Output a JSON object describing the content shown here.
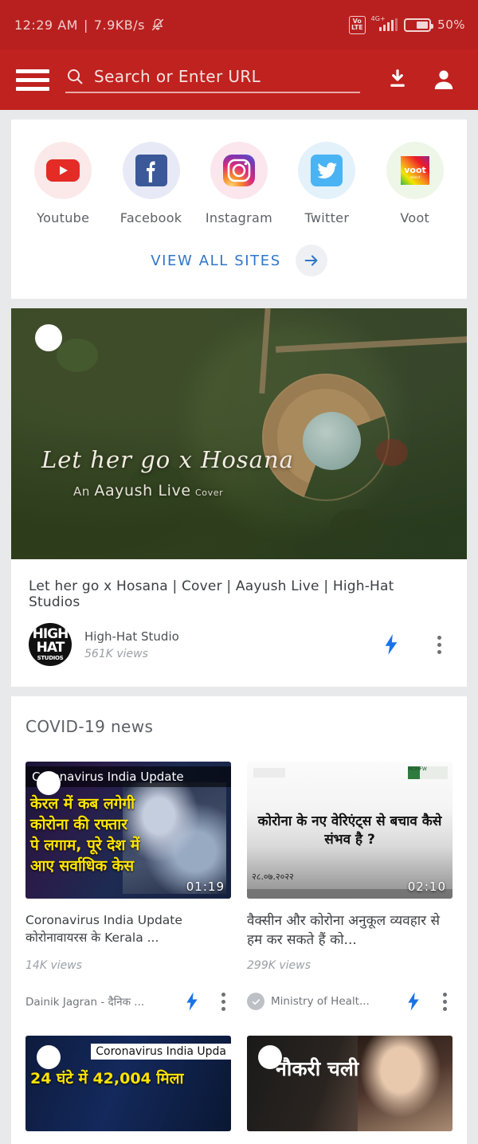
{
  "statusbar": {
    "time": "12:29 AM",
    "separator": "|",
    "netspeed": "7.9KB/s",
    "mute_icon": "bell-muted-icon",
    "volte_line1": "Vo",
    "volte_line2": "LTE",
    "signal_label": "4G+",
    "battery_pct": "50%"
  },
  "toolbar": {
    "menu_icon": "hamburger-menu-icon",
    "search_placeholder": "Search or Enter URL",
    "search_icon": "search-icon",
    "download_icon": "download-icon",
    "profile_icon": "profile-icon"
  },
  "shortcuts": {
    "tiles": [
      {
        "label": "Youtube",
        "icon": "youtube-icon",
        "bg": "#fbe9e9"
      },
      {
        "label": "Facebook",
        "icon": "facebook-icon",
        "bg": "#e7eaf6"
      },
      {
        "label": "Instagram",
        "icon": "instagram-icon",
        "bg": "#fbe6ee"
      },
      {
        "label": "Twitter",
        "icon": "twitter-icon",
        "bg": "#e3f1fb"
      },
      {
        "label": "Voot",
        "icon": "voot-icon",
        "bg": "#eef6e8"
      }
    ],
    "view_all_label": "VIEW ALL SITES",
    "view_all_arrow_icon": "arrow-right-icon"
  },
  "video": {
    "thumb_title": "Let her go x Hosana",
    "thumb_subtitle_pre": "An",
    "thumb_subtitle_mid": "Aayush Live",
    "thumb_subtitle_post": "Cover",
    "play_badge_icon": "play-badge-icon",
    "title": "Let her go x Hosana | Cover | Aayush Live | High-Hat Studios",
    "channel": "High-Hat Studio",
    "views": "561K views",
    "avatar_line1": "HIGH",
    "avatar_line2": "HAT",
    "avatar_line3": "STUDIOS",
    "bolt_icon": "lightning-bolt-icon",
    "menu_icon": "more-options-icon"
  },
  "news": {
    "heading": "COVID-19 news",
    "items": [
      {
        "banner": "Coronavirus India Update",
        "overlay_l1": "केरल में कब लगेगी",
        "overlay_l2": "कोरोना की रफ्तार",
        "overlay_l3": "पे लगाम, पूरे देश में",
        "overlay_l4": "आए सर्वाधिक केस",
        "duration": "01:19",
        "title": "Coronavirus India Update कोरोनावायरस के Kerala ...",
        "views": "14K views",
        "source": "Dainik Jagran - दैनिक ...",
        "verified": false,
        "bolt_icon": "lightning-bolt-icon",
        "menu_icon": "more-options-icon"
      },
      {
        "headline": "कोरोना के नए वेरिएंट्स से बचाव कैसे संभव है ?",
        "date": "२८.०७.२०२२",
        "duration": "02:10",
        "logo_text": "MOHFW",
        "title": "वैक्सीन और कोरोना अनुकूल व्यवहार से हम कर सकते हैं को...",
        "views": "299K views",
        "source": "Ministry of Healt...",
        "verified": true,
        "bolt_icon": "lightning-bolt-icon",
        "menu_icon": "more-options-icon"
      }
    ],
    "bottom_items": [
      {
        "banner": "Coronavirus India Upda",
        "overlay": "24 घंटे में 42,004 मिला",
        "play_icon": "play-badge-icon"
      },
      {
        "overlay": "नौकरी चली",
        "play_icon": "play-badge-icon"
      }
    ]
  }
}
